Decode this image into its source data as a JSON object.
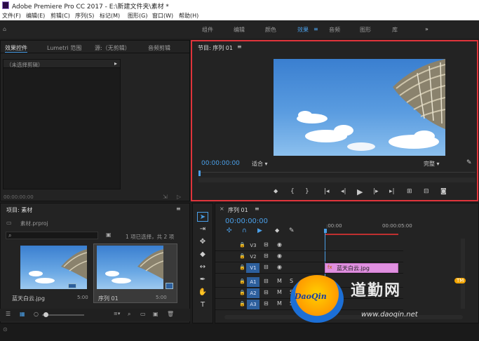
{
  "app": {
    "title": "Adobe Premiere Pro CC 2017 - E:\\新建文件夹\\素材 *"
  },
  "menu": [
    "文件(F)",
    "编辑(E)",
    "剪辑(C)",
    "序列(S)",
    "标记(M)",
    "图形(G)",
    "窗口(W)",
    "帮助(H)"
  ],
  "workspaces": [
    "组件",
    "编辑",
    "颜色",
    "效果",
    "音频",
    "图形",
    "库"
  ],
  "workspace_active": "效果",
  "source_panel": {
    "tabs": [
      "效果控件",
      "Lumetri 范围",
      "源:（无剪辑）",
      "音频剪辑"
    ],
    "no_clip": "（未选择剪辑）",
    "timecode": "00:00:00:00"
  },
  "program": {
    "tab": "节目: 序列 01",
    "timecode": "00:00:00:00",
    "fit": "适合",
    "quality": "完整"
  },
  "project": {
    "tab": "项目: 素材",
    "file": "素材.prproj",
    "selection_info": "1 项已选择，共 2 项",
    "items": [
      {
        "name": "蓝天白云.jpg",
        "duration": "5:00"
      },
      {
        "name": "序列 01",
        "duration": "5:00"
      }
    ]
  },
  "timeline": {
    "tab": "序列 01",
    "timecode": "00:00:00:00",
    "ruler": [
      ":00:00",
      "00:00:05:00"
    ],
    "video_tracks": [
      "V3",
      "V2",
      "V1"
    ],
    "audio_tracks": [
      "A1",
      "A2",
      "A3"
    ],
    "clip_label": "蓝天白云.jpg"
  },
  "watermark": {
    "brand": "DaoQin",
    "cn": "道勤网",
    "tm": "TM",
    "url": "www.daoqin.net"
  },
  "colors": {
    "accent": "#4a9fe8",
    "highlight": "#e0343b",
    "clip": "#e090e0",
    "track": "#2d5f9c"
  }
}
